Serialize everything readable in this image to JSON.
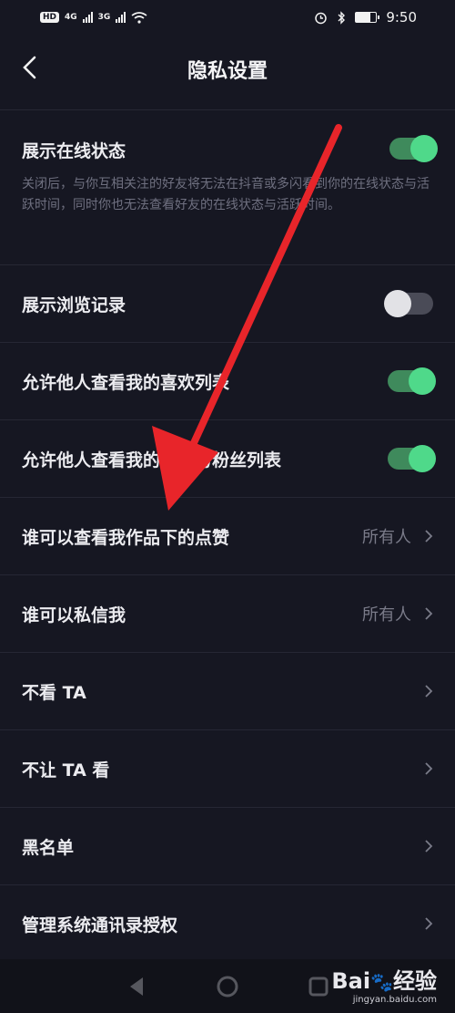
{
  "status_bar": {
    "left_badge": "HD",
    "net1": "4G",
    "net2": "3G",
    "time": "9:50",
    "battery_level": 0.7
  },
  "header": {
    "title": "隐私设置",
    "back_icon": "chevron-left-icon"
  },
  "settings": {
    "online_status": {
      "label": "展示在线状态",
      "description": "关闭后，与你互相关注的好友将无法在抖音或多闪看到你的在线状态与活跃时间，同时你也无法查看好友的在线状态与活跃时间。",
      "enabled": true
    },
    "browse_history": {
      "label": "展示浏览记录",
      "enabled": false
    },
    "likes_list": {
      "label": "允许他人查看我的喜欢列表",
      "enabled": true
    },
    "follow_fans_list": {
      "label": "允许他人查看我的关注与粉丝列表",
      "enabled": true
    },
    "who_sees_likes": {
      "label": "谁可以查看我作品下的点赞",
      "value": "所有人"
    },
    "who_can_dm": {
      "label": "谁可以私信我",
      "value": "所有人"
    },
    "dont_see": {
      "label": "不看 TA"
    },
    "dont_let_see": {
      "label": "不让 TA 看"
    },
    "blacklist": {
      "label": "黑名单"
    },
    "contacts_auth": {
      "label": "管理系统通讯录授权"
    }
  },
  "watermark": {
    "brand": "Bai",
    "brand2": "经验",
    "url": "jingyan.baidu.com"
  },
  "colors": {
    "background": "#161722",
    "toggle_on_knob": "#4fd98a",
    "toggle_on_track": "#3f8a5c",
    "arrow": "#e8252a"
  }
}
